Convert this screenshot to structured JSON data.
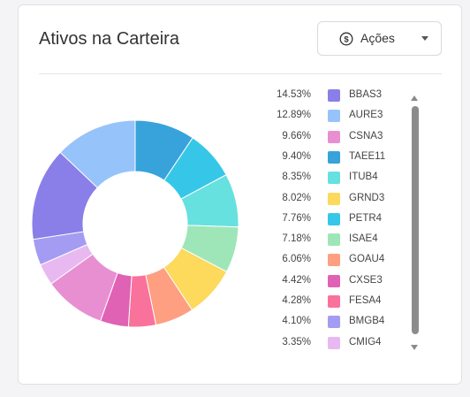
{
  "card": {
    "title": "Ativos na Carteira"
  },
  "dropdown": {
    "icon": "dollar-circle-icon",
    "selected": "Ações"
  },
  "chart_data": {
    "type": "pie",
    "categories": [
      "BBAS3",
      "AURE3",
      "CSNA3",
      "TAEE11",
      "ITUB4",
      "GRND3",
      "PETR4",
      "ISAE4",
      "GOAU4",
      "CXSE3",
      "FESA4",
      "BMGB4",
      "CMIG4"
    ],
    "values": [
      14.53,
      12.89,
      9.66,
      9.4,
      8.35,
      8.02,
      7.76,
      7.18,
      6.06,
      4.42,
      4.28,
      4.1,
      3.35
    ],
    "labels": [
      "14.53%",
      "12.89%",
      "9.66%",
      "9.40%",
      "8.35%",
      "8.02%",
      "7.76%",
      "7.18%",
      "6.06%",
      "4.42%",
      "4.28%",
      "4.10%",
      "3.35%"
    ],
    "colors": [
      "#8a7fe8",
      "#97c3fb",
      "#e88fd2",
      "#38a2db",
      "#67e0e0",
      "#fdd95c",
      "#36c7e8",
      "#9ee6b8",
      "#fd9f80",
      "#e062b4",
      "#f9729b",
      "#a49cf2",
      "#e8b9f0"
    ],
    "visible_slices": [
      {
        "value": 9.4,
        "color": "#38a2db"
      },
      {
        "value": 7.76,
        "color": "#36c7e8"
      },
      {
        "value": 8.35,
        "color": "#67e0e0"
      },
      {
        "value": 7.18,
        "color": "#9ee6b8"
      },
      {
        "value": 8.02,
        "color": "#fdd95c"
      },
      {
        "value": 6.06,
        "color": "#fd9f80"
      },
      {
        "value": 4.28,
        "color": "#f9729b"
      },
      {
        "value": 4.42,
        "color": "#e062b4"
      },
      {
        "value": 9.66,
        "color": "#e88fd2"
      },
      {
        "value": 3.35,
        "color": "#e8b9f0"
      },
      {
        "value": 4.1,
        "color": "#a49cf2"
      },
      {
        "value": 14.53,
        "color": "#8a7fe8"
      },
      {
        "value": 12.89,
        "color": "#97c3fb"
      }
    ],
    "legend_placement": "right"
  }
}
